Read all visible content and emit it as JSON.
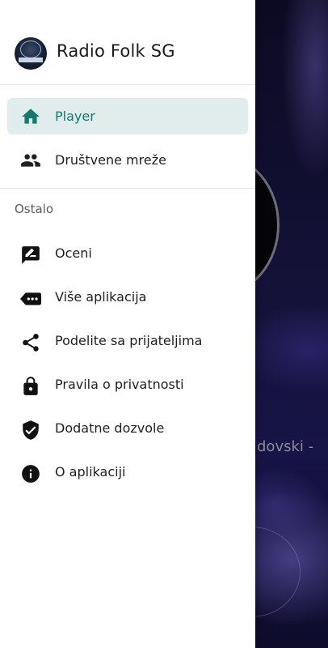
{
  "background": {
    "track_text": "dovski -"
  },
  "drawer": {
    "app_title": "Radio Folk SG",
    "logo_icon": "radio-station-logo",
    "nav": [
      {
        "label": "Player",
        "icon": "home-icon",
        "active": true
      },
      {
        "label": "Društvene mreže",
        "icon": "people-icon",
        "active": false
      }
    ],
    "section_title": "Ostalo",
    "menu": [
      {
        "label": "Oceni",
        "icon": "rate-review-icon"
      },
      {
        "label": "Više aplikacija",
        "icon": "more-apps-icon"
      },
      {
        "label": "Podelite sa prijateljima",
        "icon": "share-icon"
      },
      {
        "label": "Pravila o privatnosti",
        "icon": "lock-icon"
      },
      {
        "label": "Dodatne dozvole",
        "icon": "verified-shield-icon"
      },
      {
        "label": "O aplikaciji",
        "icon": "info-icon"
      }
    ],
    "colors": {
      "accent": "#147a6e",
      "active_bg": "#e0edec",
      "text": "#1f1f1f"
    }
  }
}
